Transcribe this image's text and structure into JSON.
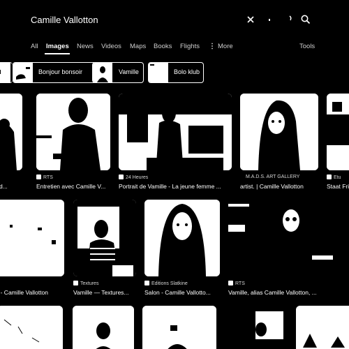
{
  "search": {
    "query": "Camille Vallotton"
  },
  "header_icons": {
    "clear": "close-icon",
    "voice": "mic-icon",
    "lens": "lens-icon",
    "search": "search-icon"
  },
  "tabs": {
    "all": "All",
    "images": "Images",
    "news": "News",
    "videos": "Videos",
    "maps": "Maps",
    "books": "Books",
    "flights": "Flights",
    "more": "More",
    "more_icon": "more-vert-icon",
    "tools": "Tools"
  },
  "chips": {
    "c1": "Bonjour bonsoir",
    "c2": "Vamille",
    "c3": "Bolo klub"
  },
  "results": {
    "r1": {
      "source": "RTS",
      "caption": "Entretien avec Camille V..."
    },
    "r2": {
      "source": "24 Heures",
      "caption": "Portrait de Vamille - La jeune femme ..."
    },
    "r3": {
      "source": "M.A.D.S. ART GALLERY",
      "caption": "artist. | Camille Vallotton"
    },
    "r4": {
      "source": "Textures",
      "caption": "Vamille — Textures..."
    },
    "r5": {
      "source": "Editions Slatkine",
      "caption": "Salon - Camille Vallotto..."
    },
    "r6": {
      "source": "RTS",
      "caption": "Vamille, alias Camille Vallotton, ..."
    },
    "r0a": {
      "caption": "ie d..."
    },
    "r0b": {
      "caption": "s - Camille Vallotton"
    },
    "r_edge": {
      "source": "Etu",
      "caption": "Staat Fri"
    }
  }
}
